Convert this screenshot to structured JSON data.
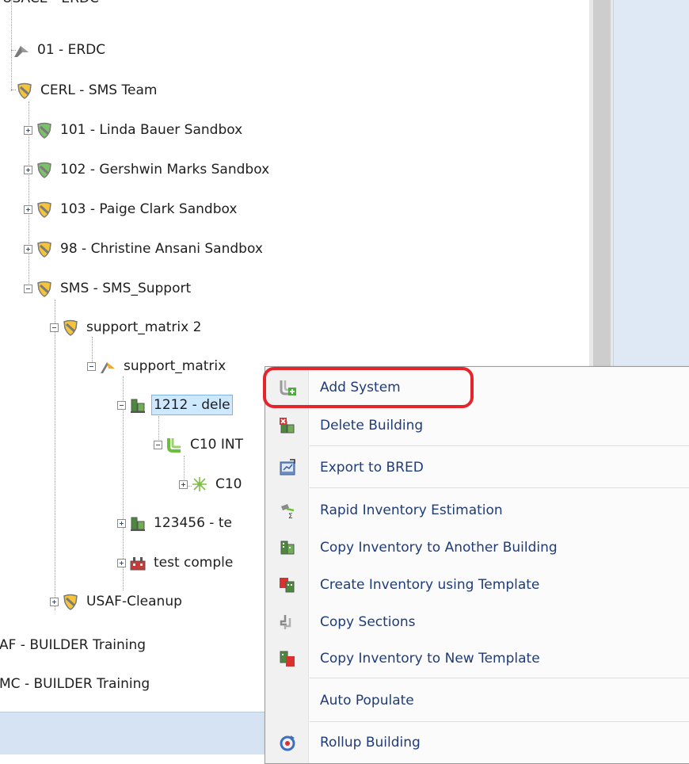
{
  "tree": {
    "top_cut": "USACE - ERDC",
    "nodes": [
      {
        "key": "n01",
        "label": "01 - ERDC",
        "icon": "flag-icon"
      },
      {
        "key": "cerl",
        "label": "CERL - SMS Team",
        "icon": "shield-icon"
      },
      {
        "key": "n101",
        "label": "101 - Linda Bauer Sandbox",
        "icon": "shield-icon"
      },
      {
        "key": "n102",
        "label": "102 - Gershwin Marks Sandbox",
        "icon": "shield-icon"
      },
      {
        "key": "n103",
        "label": "103 - Paige Clark Sandbox",
        "icon": "shield-icon"
      },
      {
        "key": "n98",
        "label": "98 - Christine Ansani Sandbox",
        "icon": "shield-icon"
      },
      {
        "key": "sms",
        "label": "SMS - SMS_Support",
        "icon": "shield-icon"
      },
      {
        "key": "sm2",
        "label": "support_matrix 2",
        "icon": "shield-icon"
      },
      {
        "key": "smx",
        "label": "support_matrix",
        "icon": "flag-icon"
      },
      {
        "key": "b1212",
        "label": "1212 - dele",
        "icon": "building-icon"
      },
      {
        "key": "c10int",
        "label": "C10 INT",
        "icon": "system-icon"
      },
      {
        "key": "c10",
        "label": "C10",
        "icon": "component-icon"
      },
      {
        "key": "b123456",
        "label": "123456 - te",
        "icon": "building-icon"
      },
      {
        "key": "complex",
        "label": "test comple",
        "icon": "complex-icon"
      },
      {
        "key": "usaf",
        "label": "USAF-Cleanup",
        "icon": "shield-icon"
      },
      {
        "key": "af",
        "label": "AF - BUILDER Training",
        "icon": ""
      },
      {
        "key": "mc",
        "label": "MC - BUILDER Training",
        "icon": ""
      }
    ]
  },
  "context_menu": {
    "items": [
      {
        "label": "Add System",
        "icon": "add-system-icon"
      },
      {
        "label": "Delete Building",
        "icon": "delete-building-icon"
      },
      {
        "label": "Export to BRED",
        "icon": "export-icon"
      },
      {
        "label": "Rapid Inventory Estimation",
        "icon": "rapid-inventory-icon"
      },
      {
        "label": "Copy Inventory to Another Building",
        "icon": "copy-inventory-icon"
      },
      {
        "label": "Create Inventory using Template",
        "icon": "template-icon"
      },
      {
        "label": "Copy Sections",
        "icon": "copy-sections-icon"
      },
      {
        "label": "Copy Inventory to New Template",
        "icon": "new-template-icon"
      },
      {
        "label": "Auto Populate",
        "icon": ""
      },
      {
        "label": "Rollup Building",
        "icon": "rollup-icon"
      }
    ]
  },
  "colors": {
    "menu_text": "#1f3c78",
    "selection_bg": "#cde8ff",
    "highlight_ring": "#e4262c"
  }
}
